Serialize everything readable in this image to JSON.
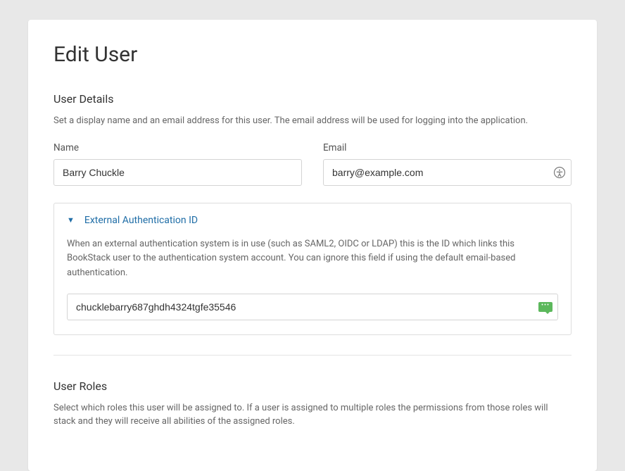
{
  "page": {
    "title": "Edit User"
  },
  "user_details": {
    "heading": "User Details",
    "description": "Set a display name and an email address for this user. The email address will be used for logging into the application.",
    "name_label": "Name",
    "name_value": "Barry Chuckle",
    "email_label": "Email",
    "email_value": "barry@example.com"
  },
  "external_auth": {
    "title": "External Authentication ID",
    "description": "When an external authentication system is in use (such as SAML2, OIDC or LDAP) this is the ID which links this BookStack user to the authentication system account. You can ignore this field if using the default email-based authentication.",
    "value": "chucklebarry687ghdh4324tgfe35546"
  },
  "user_roles": {
    "heading": "User Roles",
    "description": "Select which roles this user will be assigned to. If a user is assigned to multiple roles the permissions from those roles will stack and they will receive all abilities of the assigned roles."
  }
}
